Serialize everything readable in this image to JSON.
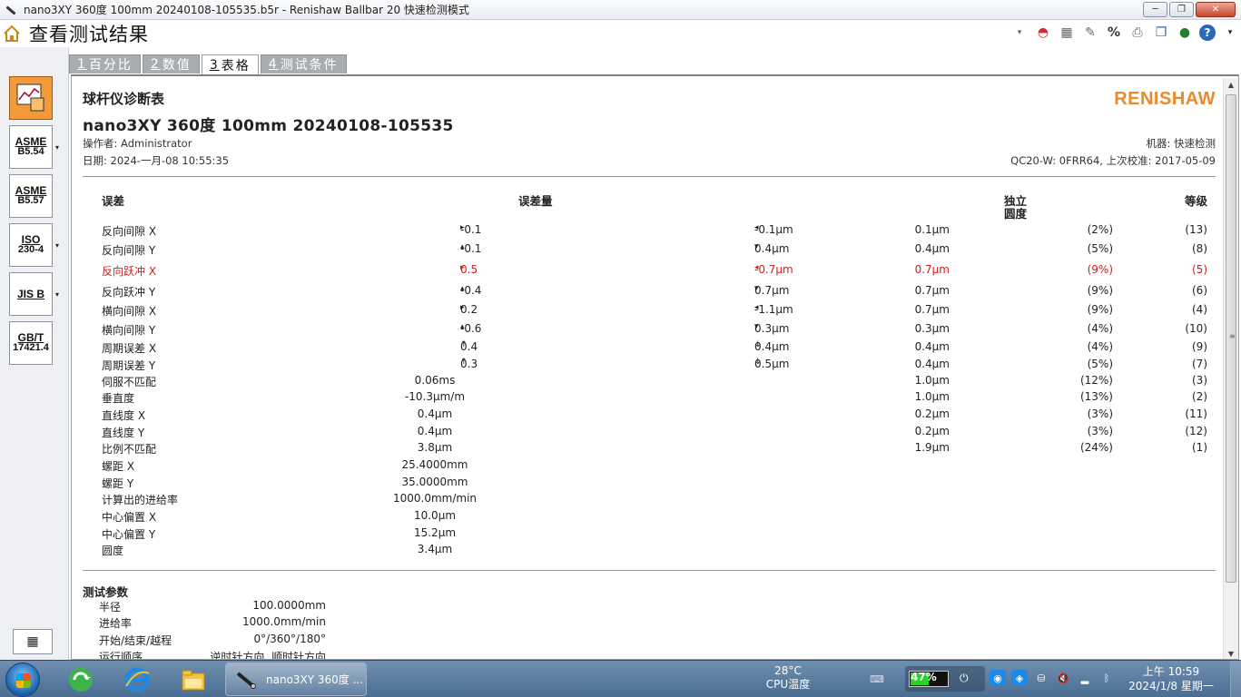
{
  "window": {
    "title": "nano3XY 360度 100mm 20240108-105535.b5r - Renishaw Ballbar 20 快速检测模式",
    "min": "─",
    "max": "❐",
    "close": "✕"
  },
  "app": {
    "page_title": "查看测试结果"
  },
  "rail": [
    {
      "label": "ASME",
      "sub": "B5.54"
    },
    {
      "label": "ASME",
      "sub": "B5.57"
    },
    {
      "label": "ISO",
      "sub": "230-4"
    },
    {
      "label": "JIS B",
      "sub": ""
    },
    {
      "label": "GB/T",
      "sub": "17421.4"
    }
  ],
  "tabs": [
    {
      "num": "1",
      "label": "百分比"
    },
    {
      "num": "2",
      "label": "数值"
    },
    {
      "num": "3",
      "label": "表格"
    },
    {
      "num": "4",
      "label": "测试条件"
    }
  ],
  "report": {
    "title": "球杆仪诊断表",
    "subtitle": "nano3XY 360度  100mm 20240108-105535",
    "logo": "RENISHAW",
    "operator": "操作者: Administrator",
    "date": "日期: 2024-一月-08 10:55:35",
    "machine": "机器: 快速检测",
    "device": "QC20-W: 0FRR64, 上次校准: 2017-05-09",
    "headers": {
      "error": "误差",
      "amount": "误差量",
      "independent_1": "独立",
      "independent_2": "圆度",
      "grade": "等级"
    },
    "rows": [
      {
        "name": "反向间隙  X",
        "a1": "▸",
        "v1": "-0.1",
        "a2": "◂",
        "v2": "-0.1μm",
        "v3": "0.1μm",
        "v4": "(2%)",
        "v5": "(13)",
        "red": false
      },
      {
        "name": "反向间隙  Y",
        "a1": "▴",
        "v1": "-0.1",
        "a2": "▾",
        "v2": "0.4μm",
        "v3": "0.4μm",
        "v4": "(5%)",
        "v5": "(8)",
        "red": false
      },
      {
        "name": "反向跃冲  X",
        "a1": "▸",
        "v1": "0.5",
        "a2": "◂",
        "v2": "-0.7μm",
        "v3": "0.7μm",
        "v4": "(9%)",
        "v5": "(5)",
        "red": true
      },
      {
        "name": "反向跃冲  Y",
        "a1": "▴",
        "v1": "-0.4",
        "a2": "▾",
        "v2": "0.7μm",
        "v3": "0.7μm",
        "v4": "(9%)",
        "v5": "(6)",
        "red": false
      },
      {
        "name": "横向间隙  X",
        "a1": "▸",
        "v1": "0.2",
        "a2": "◂",
        "v2": "-1.1μm",
        "v3": "0.7μm",
        "v4": "(9%)",
        "v5": "(4)",
        "red": false
      },
      {
        "name": "横向间隙  Y",
        "a1": "▴",
        "v1": "-0.6",
        "a2": "▾",
        "v2": "0.3μm",
        "v3": "0.3μm",
        "v4": "(4%)",
        "v5": "(10)",
        "red": false
      },
      {
        "name": "周期误差  X",
        "a1": "↑",
        "v1": "0.4",
        "a2": "↓",
        "v2": "0.4μm",
        "v3": "0.4μm",
        "v4": "(4%)",
        "v5": "(9)",
        "red": false
      },
      {
        "name": "周期误差  Y",
        "a1": "↑",
        "v1": "0.3",
        "a2": "↓",
        "v2": "0.5μm",
        "v3": "0.4μm",
        "v4": "(5%)",
        "v5": "(7)",
        "red": false
      },
      {
        "name": "伺服不匹配",
        "a1": "",
        "v1": "0.06ms",
        "a2": "",
        "v2": "",
        "v3": "1.0μm",
        "v4": "(12%)",
        "v5": "(3)",
        "red": false,
        "center": true
      },
      {
        "name": "垂直度",
        "a1": "",
        "v1": "-10.3μm/m",
        "a2": "",
        "v2": "",
        "v3": "1.0μm",
        "v4": "(13%)",
        "v5": "(2)",
        "red": false,
        "center": true
      },
      {
        "name": "直线度  X",
        "a1": "",
        "v1": "0.4μm",
        "a2": "",
        "v2": "",
        "v3": "0.2μm",
        "v4": "(3%)",
        "v5": "(11)",
        "red": false,
        "center": true
      },
      {
        "name": "直线度  Y",
        "a1": "",
        "v1": "0.4μm",
        "a2": "",
        "v2": "",
        "v3": "0.2μm",
        "v4": "(3%)",
        "v5": "(12)",
        "red": false,
        "center": true
      },
      {
        "name": "比例不匹配",
        "a1": "",
        "v1": "3.8μm",
        "a2": "",
        "v2": "",
        "v3": "1.9μm",
        "v4": "(24%)",
        "v5": "(1)",
        "red": false,
        "center": true
      },
      {
        "name": "螺距  X",
        "a1": "",
        "v1": "25.4000mm",
        "a2": "",
        "v2": "",
        "v3": "",
        "v4": "",
        "v5": "",
        "red": false,
        "center": true
      },
      {
        "name": "螺距  Y",
        "a1": "",
        "v1": "35.0000mm",
        "a2": "",
        "v2": "",
        "v3": "",
        "v4": "",
        "v5": "",
        "red": false,
        "center": true
      },
      {
        "name": "计算出的进给率",
        "a1": "",
        "v1": "1000.0mm/min",
        "a2": "",
        "v2": "",
        "v3": "",
        "v4": "",
        "v5": "",
        "red": false,
        "center": true
      },
      {
        "name": "中心偏置  X",
        "a1": "",
        "v1": "10.0μm",
        "a2": "",
        "v2": "",
        "v3": "",
        "v4": "",
        "v5": "",
        "red": false,
        "center": true
      },
      {
        "name": "中心偏置  Y",
        "a1": "",
        "v1": "15.2μm",
        "a2": "",
        "v2": "",
        "v3": "",
        "v4": "",
        "v5": "",
        "red": false,
        "center": true
      },
      {
        "name": "圆度",
        "a1": "",
        "v1": "3.4μm",
        "a2": "",
        "v2": "",
        "v3": "",
        "v4": "",
        "v5": "",
        "red": false,
        "center": true
      }
    ],
    "params_title": "测试参数",
    "params": [
      {
        "label": "半径",
        "value": "100.0000mm"
      },
      {
        "label": "进给率",
        "value": "1000.0mm/min"
      },
      {
        "label": "开始/结束/越程",
        "value": "0°/360°/180°"
      },
      {
        "label": "运行顺序",
        "value": "逆时针方向, 顺时针方向"
      }
    ]
  },
  "taskbar": {
    "task_label": "nano3XY 360度 ...",
    "temp_value": "28°C",
    "temp_label": "CPU温度",
    "battery_pct": "47%",
    "battery_level": 0.47,
    "clock_time": "上午 10:59",
    "clock_date": "2024/1/8 星期一"
  },
  "colors": {
    "accent_orange": "#f39a3a",
    "logo": "#e98a2b",
    "alert_red": "#d02020",
    "tab_inactive": "#a9adb2"
  }
}
